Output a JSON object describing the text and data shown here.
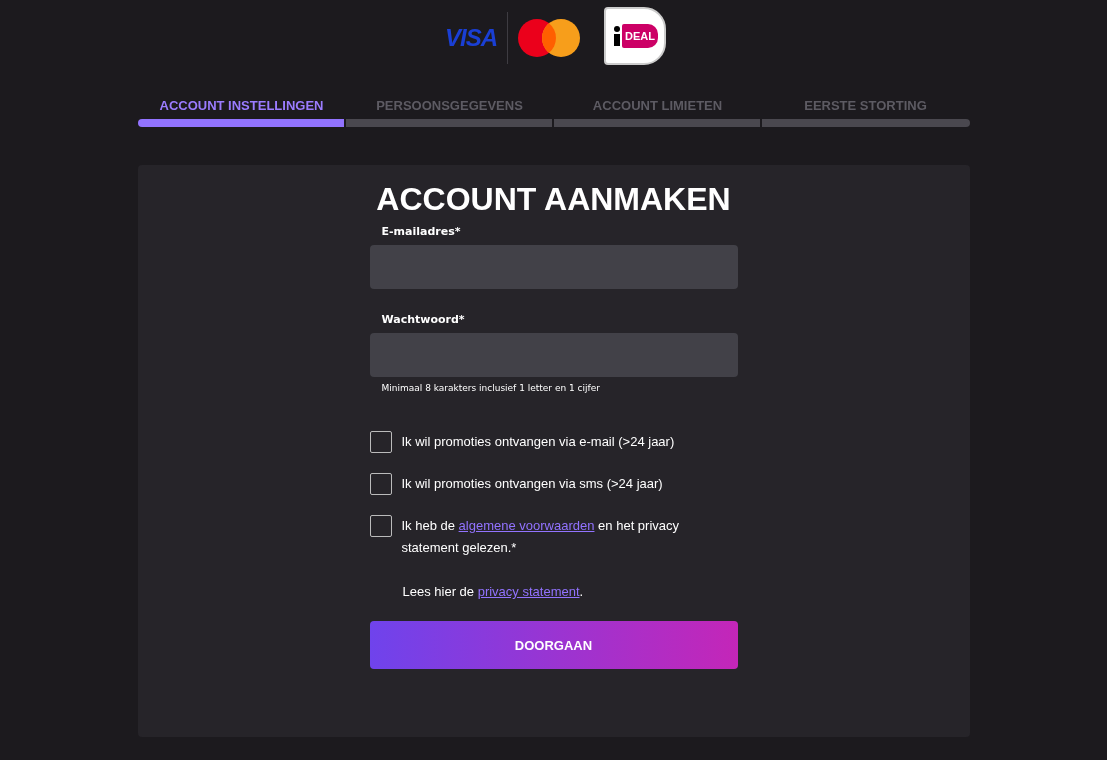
{
  "payment_logos": {
    "visa": "VISA",
    "ideal": "DEAL"
  },
  "steps": [
    {
      "label": "ACCOUNT INSTELLINGEN",
      "selected": true
    },
    {
      "label": "PERSOONSGEGEVENS",
      "selected": false
    },
    {
      "label": "ACCOUNT LIMIETEN",
      "selected": false
    },
    {
      "label": "EERSTE STORTING",
      "selected": false
    }
  ],
  "form": {
    "title": "ACCOUNT AANMAKEN",
    "fields": [
      {
        "label": "E-mailadres*"
      },
      {
        "label": "Wachtwoord*",
        "hint": "Minimaal 8 karakters inclusief 1 letter en 1 cijfer"
      }
    ],
    "checkboxes": [
      {
        "text_before": "Ik wil promoties ontvangen via e-mail (>24 jaar)",
        "checked": false
      },
      {
        "text_before": "Ik wil promoties ontvangen via sms (>24 jaar)",
        "checked": false
      },
      {
        "text_before": "Ik heb de ",
        "link": "algemene voorwaarden",
        "text_after": " en het privacy statement gelezen.*",
        "checked": false
      }
    ],
    "privacy_note": {
      "text_before": "Lees hier de ",
      "link": "privacy statement",
      "text_after": "."
    },
    "submit": "DOORGAAN"
  }
}
